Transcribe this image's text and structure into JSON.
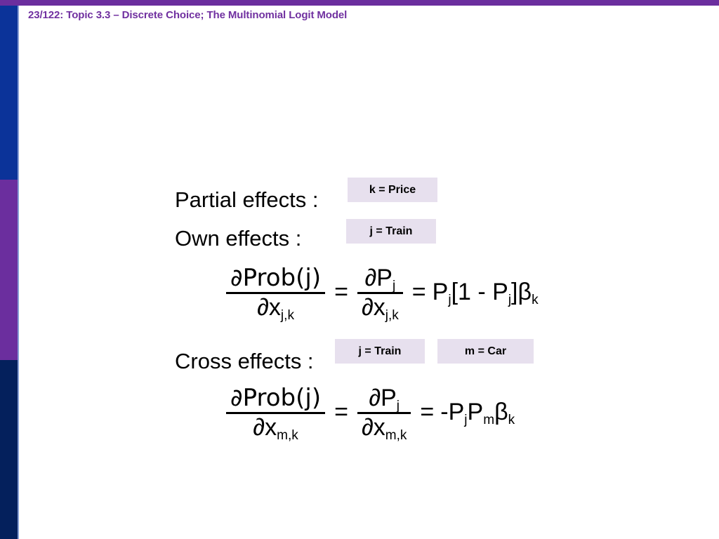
{
  "slide": {
    "title": "23/122: Topic 3.3 – Discrete Choice; The Multinomial Logit Model",
    "title_color": "#7030a0"
  },
  "decor": {
    "top_bar_color": "#6b2e9e",
    "sidebar_bands": [
      {
        "name": "blue-band",
        "color": "#0b3399"
      },
      {
        "name": "purple-band",
        "color": "#6b2e9e"
      },
      {
        "name": "navy-band",
        "color": "#04205c"
      }
    ]
  },
  "body": {
    "labels": {
      "partial_effects": "Partial effects :",
      "own_effects": "Own effects :",
      "cross_effects": "Cross effects :"
    },
    "chips": {
      "k_price": "k = Price",
      "j_train_own": "j = Train",
      "j_train_cross": "j = Train",
      "m_car": "m = Car",
      "background_color": "#e7e0ee"
    },
    "equations": {
      "own": {
        "numerator_1": "∂Prob(j)",
        "denominator_1": "∂x",
        "denominator_1_sub": "j,k",
        "equals_1": "=",
        "numerator_2": "∂P",
        "numerator_2_sub": "j",
        "denominator_2": "∂x",
        "denominator_2_sub": "j,k",
        "equals_2": "=",
        "rhs_a": "P",
        "rhs_a_sub": "j",
        "rhs_b": "[1 - P",
        "rhs_b_sub": "j",
        "rhs_c": "]β",
        "rhs_c_sub": "k"
      },
      "cross": {
        "numerator_1": "∂Prob(j)",
        "denominator_1": "∂x",
        "denominator_1_sub": "m,k",
        "equals_1": "=",
        "numerator_2": "∂P",
        "numerator_2_sub": "j",
        "denominator_2": "∂x",
        "denominator_2_sub": "m,k",
        "equals_2": "=",
        "rhs_a": "-P",
        "rhs_a_sub": "j",
        "rhs_b": "P",
        "rhs_b_sub": "m",
        "rhs_c": "β",
        "rhs_c_sub": "k"
      }
    }
  }
}
